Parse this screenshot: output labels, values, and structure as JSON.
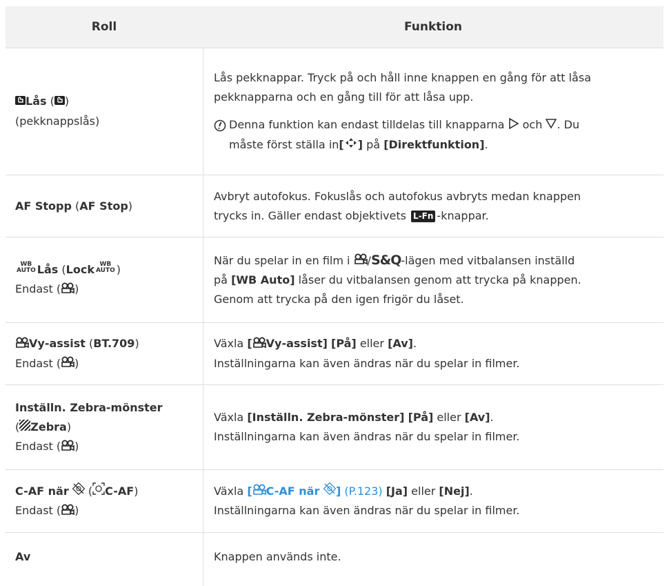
{
  "header": {
    "col_roll": "Roll",
    "col_funktion": "Funktion"
  },
  "icons": {
    "touch_lock": "touch-lock-icon",
    "movie": "movie-camera-icon",
    "wb_auto": "wb-auto-icon",
    "zebra": "zebra-pattern-icon",
    "no_face": "no-face-icon",
    "face_c_af": "face-c-af-icon",
    "note": "caution-icon",
    "lfn": "lens-fn-icon",
    "arrow_right": "triangle-right-icon",
    "arrow_down": "triangle-down-icon",
    "four_way": "four-way-arrows-icon"
  },
  "colors": {
    "header_bg": "#f2f2f2",
    "link": "#2f8fd8",
    "border": "#dedede"
  },
  "rows": {
    "r1": {
      "roll_name": "Lås",
      "roll_sub": "(pekknappslås)",
      "func_line1": "Lås pekknappar. Tryck på och håll inne knappen en gång för att låsa",
      "func_line2": "pekknapparna och en gång till för att låsa upp.",
      "note_a": "Denna funktion kan endast tilldelas till knapparna",
      "note_och": "och",
      "note_b": ". Du",
      "note_c": "måste först ställa in",
      "note_bracket_open": "[",
      "note_bracket_close": "]",
      "note_pa": "på",
      "note_setting": "[Direktfunktion]",
      "note_end": "."
    },
    "r2": {
      "roll_a": "AF Stopp",
      "roll_b": "AF Stop",
      "func_line1": "Avbryt autofokus. Fokuslås och autofokus avbryts medan knappen",
      "func_line2a": "trycks in. Gäller endast objektivets",
      "func_lfn": "L-Fn",
      "func_line2b": "-knappar."
    },
    "r3": {
      "wb_top": "WB",
      "wb_bottom": "AUTO",
      "roll_a": "Lås",
      "roll_b": "Lock",
      "roll_sub": "Endast (",
      "roll_sub_end": ")",
      "func_line1a": "När du spelar in en film i",
      "func_sq": "S&Q",
      "func_line1b": "-lägen med vitbalansen inställd",
      "func_line2a": "på",
      "func_wb_auto": "[WB Auto]",
      "func_line2b": "låser du vitbalansen genom att trycka på knappen.",
      "func_line3": "Genom att trycka på den igen frigör du låset."
    },
    "r4": {
      "roll_a": "Vy-assist",
      "roll_b": "BT.709",
      "roll_sub": "Endast (",
      "roll_sub_end": ")",
      "func_vaxla": "Växla",
      "func_setting": "Vy-assist]",
      "func_pa": "[På]",
      "func_eller": "eller",
      "func_av": "[Av]",
      "func_line2": "Inställningarna kan även ändras när du spelar in filmer."
    },
    "r5": {
      "roll_line1": "Inställn. Zebra-mönster",
      "roll_zebra": "Zebra",
      "roll_sub": "Endast (",
      "roll_sub_end": ")",
      "func_vaxla": "Växla",
      "func_setting": "[Inställn. Zebra-mönster]",
      "func_pa": "[På]",
      "func_eller": "eller",
      "func_av": "[Av]",
      "func_line2": "Inställningarna kan även ändras när du spelar in filmer."
    },
    "r6": {
      "roll_a": "C-AF när",
      "roll_b": "C-AF",
      "roll_sub": "Endast (",
      "roll_sub_end": ")",
      "func_vaxla": "Växla",
      "func_link": "C-AF när",
      "func_page": "(P.123)",
      "func_ja": "[Ja]",
      "func_eller": "eller",
      "func_nej": "[Nej]",
      "func_line2": "Inställningarna kan även ändras när du spelar in filmer."
    },
    "r7": {
      "roll": "Av",
      "func": "Knappen används inte."
    }
  }
}
